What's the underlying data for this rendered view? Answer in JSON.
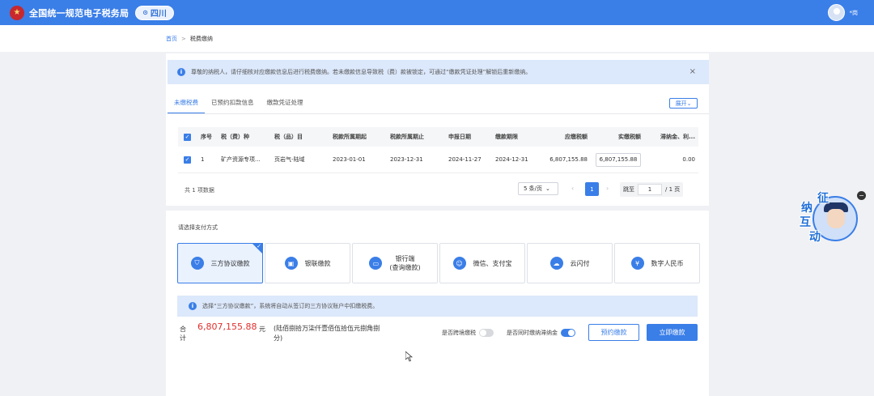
{
  "header": {
    "app_title": "全国统一规范电子税务局",
    "region": "四川",
    "user_name": "*岗"
  },
  "breadcrumb": {
    "home": "首页",
    "separator": ">",
    "current": "税费缴纳"
  },
  "notice": {
    "text": "尊敬的纳税人，请仔细核对应缴款信息后进行税费缴纳。若未缴款信息导致税（费）款被锁定，可通过“缴款凭证处理”解锁后重新缴纳。",
    "close": "×"
  },
  "tabs": [
    {
      "label": "未缴税费"
    },
    {
      "label": "已预约扣款信息"
    },
    {
      "label": "缴款凭证处理"
    }
  ],
  "expand_label": "展开",
  "table": {
    "headers": [
      "序号",
      "税（费）种",
      "税（品）目",
      "税款所属期起",
      "税款所属期止",
      "申报日期",
      "缴款期限",
      "应缴税额",
      "实缴税额",
      "滞纳金、利..."
    ],
    "rows": [
      {
        "index": "1",
        "tax_type": "矿产资源专项...",
        "tax_item": "页岩气-陆域",
        "period_start": "2023-01-01",
        "period_end": "2023-12-31",
        "declare_date": "2024-11-27",
        "deadline": "2024-12-31",
        "due_amount": "6,807,155.88",
        "paid_amount": "6,807,155.88",
        "late_fee": "0.00"
      }
    ]
  },
  "pager": {
    "total_text": "共 1 项数据",
    "page_size": "5 条/页",
    "current_page": "1",
    "jump_label": "跳至",
    "jump_value": "1",
    "total_pages": "/ 1 页"
  },
  "payment": {
    "title": "请选择支付方式",
    "options": [
      {
        "label": "三方协议缴款",
        "icon": "shield-icon",
        "selected": true
      },
      {
        "label": "银联缴款",
        "icon": "unionpay-icon",
        "selected": false
      },
      {
        "label": "银行端",
        "label2": "(查询缴款)",
        "icon": "bank-card-icon",
        "selected": false
      },
      {
        "label": "微信、支付宝",
        "icon": "wechat-alipay-icon",
        "selected": false
      },
      {
        "label": "云闪付",
        "icon": "cloud-pay-icon",
        "selected": false
      },
      {
        "label": "数字人民币",
        "icon": "digital-rmb-icon",
        "selected": false
      }
    ],
    "tip": "选择“三方协议缴款”，系统将自动从签订的三方协议账户中扣缴税费。"
  },
  "summary": {
    "label": "合计",
    "amount": "6,807,155.88",
    "unit": "元",
    "amount_words": "(陆佰捌拾万柒仟壹佰伍拾伍元捌角捌分)"
  },
  "toggles": {
    "cross_region": {
      "label": "是否跨境缴税",
      "on": false
    },
    "late_fee_together": {
      "label": "是否同时缴纳滞纳金",
      "on": true
    }
  },
  "buttons": {
    "schedule": "预约缴款",
    "pay_now": "立即缴款"
  },
  "helper": {
    "chars": [
      "征",
      "纳",
      "互",
      "动"
    ],
    "close": "−"
  },
  "colors": {
    "primary": "#3a7ee8",
    "amount": "#e0302d",
    "notice_bg": "#dce8fb"
  }
}
